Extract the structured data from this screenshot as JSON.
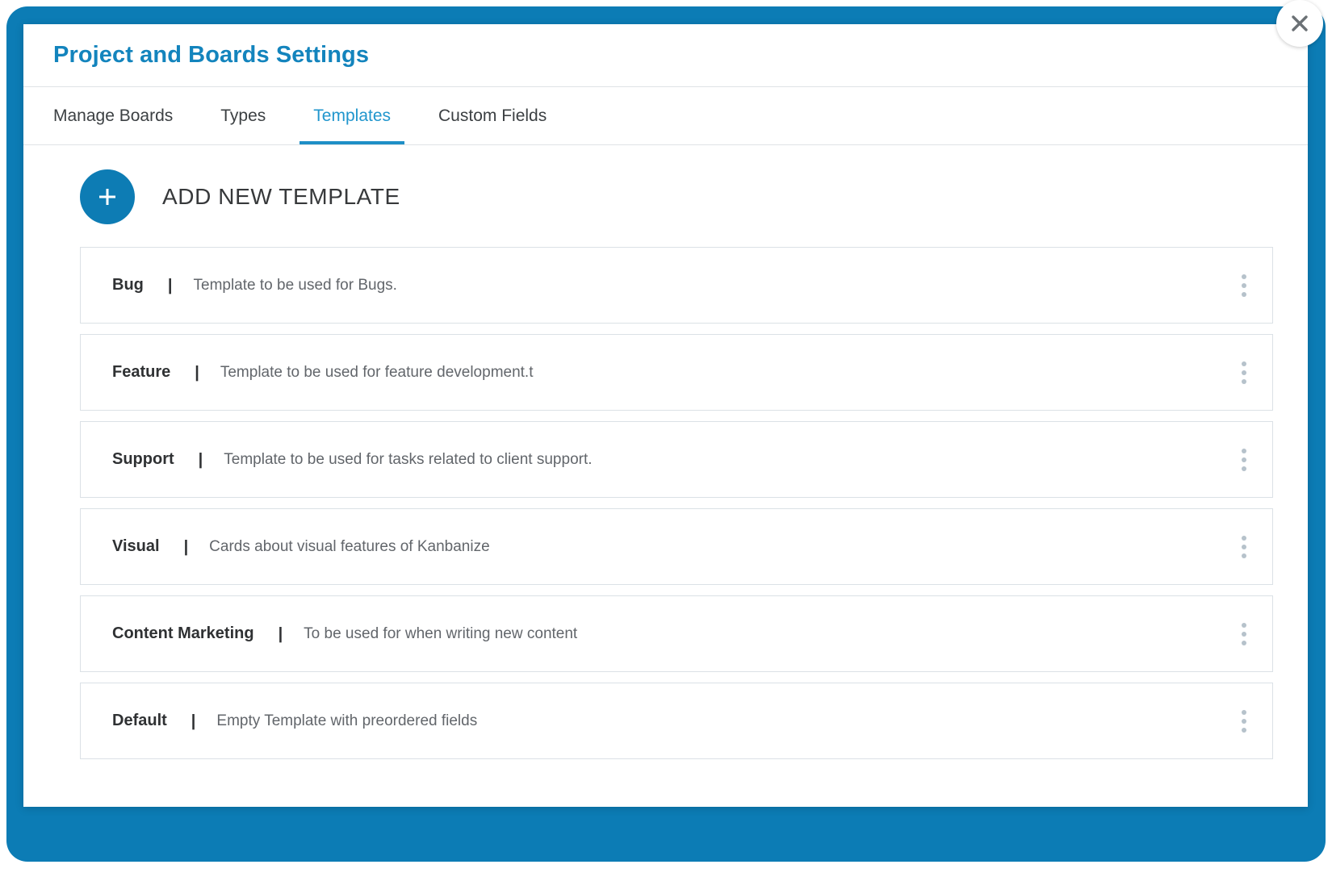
{
  "dialog": {
    "title": "Project and Boards Settings",
    "close_icon": "close-icon"
  },
  "tabs": [
    {
      "label": "Manage Boards",
      "active": false
    },
    {
      "label": "Types",
      "active": false
    },
    {
      "label": "Templates",
      "active": true
    },
    {
      "label": "Custom Fields",
      "active": false
    }
  ],
  "add_new": {
    "label": "ADD NEW TEMPLATE",
    "icon": "plus-icon"
  },
  "templates": {
    "separator": "|",
    "menu_icon": "kebab-menu-icon",
    "items": [
      {
        "name": "Bug",
        "description": "Template to be used for Bugs."
      },
      {
        "name": "Feature",
        "description": "Template to be used for feature development.t"
      },
      {
        "name": "Support",
        "description": "Template to be used for tasks related to client support."
      },
      {
        "name": "Visual",
        "description": "Cards about visual features of Kanbanize"
      },
      {
        "name": "Content Marketing",
        "description": "To be used for when writing new content"
      },
      {
        "name": "Default",
        "description": "Empty Template with preordered fields"
      }
    ]
  },
  "colors": {
    "brand_blue": "#0d7cb4",
    "title_blue": "#1384bd",
    "active_tab_blue": "#2196cd",
    "card_border": "#dbe1e6",
    "kebab_dot": "#b6c2cb"
  }
}
